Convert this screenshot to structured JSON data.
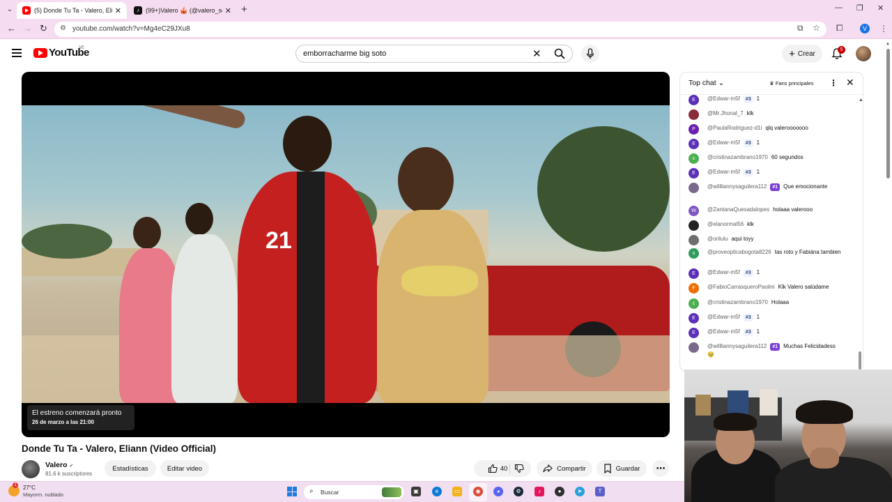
{
  "browser": {
    "tabs": [
      {
        "title": "(5) Donde Tu Ta - Valero, Eliann",
        "active": true
      },
      {
        "title": "(99+)Valero 🎪 (@valero_soy) |",
        "active": false
      }
    ],
    "url": "youtube.com/watch?v=Mg4eC29JXu8",
    "profile_initial": "V"
  },
  "youtube": {
    "logo_text": "YouTube",
    "country_code": "VE",
    "search_query": "emborracharme big soto",
    "create_label": "Crear",
    "notifications_count": "5",
    "colors": {
      "brand_red": "#ff0000",
      "badge_red": "#cc0000",
      "rank_one_purple": "#7b3cd8"
    }
  },
  "video": {
    "premiere_status": "El estreno comenzará pronto",
    "premiere_date": "26 de marzo a las 21:00",
    "title": "Donde Tu Ta - Valero, Eliann (Video Official)",
    "jersey_number": "21",
    "channel": {
      "name": "Valero",
      "subscribers": "81.6 k suscriptores"
    },
    "buttons": {
      "stats": "Estadísticas",
      "edit": "Editar video",
      "likes": "40",
      "share": "Compartir",
      "save": "Guardar"
    }
  },
  "chat": {
    "mode": "Top chat",
    "fans_filter": "Fans principales",
    "messages": [
      {
        "author": "@Edwar-m5f",
        "rank": "#3",
        "text": "1",
        "avatar": "E",
        "color": "#5b2fb8"
      },
      {
        "author": "@Mr.Jhonal_7",
        "rank": "",
        "text": "klk",
        "avatar": "",
        "color": "#8a2b3a"
      },
      {
        "author": "@PaulaRodriguez-d1i",
        "rank": "",
        "text": "qlq valerooooooo",
        "avatar": "P",
        "color": "#6a1fb0"
      },
      {
        "author": "@Edwar-m5f",
        "rank": "#3",
        "text": "1",
        "avatar": "E",
        "color": "#5b2fb8"
      },
      {
        "author": "@cristinazambrano1970",
        "rank": "",
        "text": "60 segundos",
        "avatar": "c",
        "color": "#4caf50"
      },
      {
        "author": "@Edwar-m5f",
        "rank": "#3",
        "text": "1",
        "avatar": "E",
        "color": "#5b2fb8"
      },
      {
        "author": "@willliannysaguilera112",
        "rank": "#1",
        "text": "Que emocionante",
        "avatar": "",
        "color": "#7a6a8a"
      },
      {
        "author": "@ZantanaQuesadalopes",
        "rank": "",
        "text": "holaaa valerooo",
        "avatar": "W",
        "color": "#7e57c2"
      },
      {
        "author": "@elanormal56",
        "rank": "",
        "text": "klk",
        "avatar": "",
        "color": "#222222"
      },
      {
        "author": "@orilulu",
        "rank": "",
        "text": "aqui toyy",
        "avatar": "",
        "color": "#6f6f6f"
      },
      {
        "author": "@proveopticabogota8226",
        "rank": "",
        "text": "tas roto y Fabiána tambien",
        "avatar": "o",
        "color": "#2e9c5a"
      },
      {
        "author": "@Edwar-m5f",
        "rank": "#3",
        "text": "1",
        "avatar": "E",
        "color": "#5b2fb8"
      },
      {
        "author": "@FabioCarrasqueroPaolini",
        "rank": "",
        "text": "Klk Valero salúdame",
        "avatar": "F",
        "color": "#ef6c00"
      },
      {
        "author": "@cristinazambrano1970",
        "rank": "",
        "text": "Holaaa",
        "avatar": "c",
        "color": "#4caf50"
      },
      {
        "author": "@Edwar-m5f",
        "rank": "#3",
        "text": "1",
        "avatar": "E",
        "color": "#5b2fb8"
      },
      {
        "author": "@Edwar-m5f",
        "rank": "#3",
        "text": "1",
        "avatar": "E",
        "color": "#5b2fb8"
      },
      {
        "author": "@willliannysaguilera112",
        "rank": "#1",
        "text": "Muchas Felicidadess 🥹",
        "avatar": "",
        "color": "#7a6a8a"
      }
    ]
  },
  "taskbar": {
    "temperature": "27°C",
    "condition": "Mayorm. nublado",
    "weather_alert": "1",
    "search_placeholder": "Buscar"
  }
}
